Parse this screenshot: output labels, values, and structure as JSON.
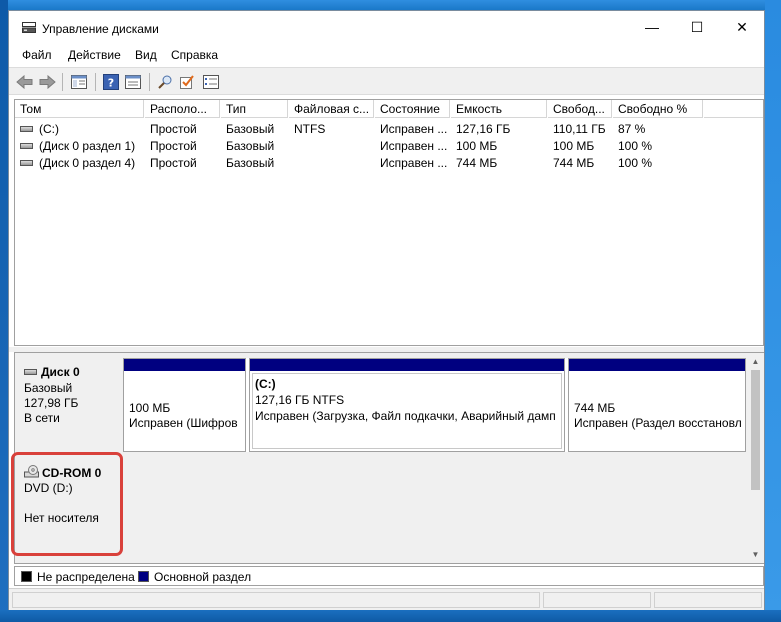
{
  "window": {
    "title": "Управление дисками",
    "controls": {
      "minimize": "—",
      "maximize": "☐",
      "close": "✕"
    }
  },
  "menu": [
    "Файл",
    "Действие",
    "Вид",
    "Справка"
  ],
  "toolbar": [
    "back-arrow-icon",
    "forward-arrow-icon",
    "console-tree-icon",
    "help-icon",
    "properties-pane-icon",
    "rescan-icon",
    "check-icon",
    "list-view-icon"
  ],
  "volume_list": {
    "columns": [
      "Том",
      "Располо...",
      "Тип",
      "Файловая с...",
      "Состояние",
      "Емкость",
      "Свобод...",
      "Свободно %"
    ],
    "rows": [
      [
        "(C:)",
        "Простой",
        "Базовый",
        "NTFS",
        "Исправен ...",
        "127,16 ГБ",
        "110,11 ГБ",
        "87 %"
      ],
      [
        "(Диск 0 раздел 1)",
        "Простой",
        "Базовый",
        "",
        "Исправен ...",
        "100 МБ",
        "100 МБ",
        "100 %"
      ],
      [
        "(Диск 0 раздел 4)",
        "Простой",
        "Базовый",
        "",
        "Исправен ...",
        "744 МБ",
        "744 МБ",
        "100 %"
      ]
    ]
  },
  "disks": {
    "disk0": {
      "name": "Диск 0",
      "type": "Базовый",
      "size": "127,98 ГБ",
      "status": "В сети",
      "partitions": [
        {
          "title": "",
          "size": "100 МБ",
          "status": "Исправен (Шифров"
        },
        {
          "title": "(C:)",
          "size": "127,16 ГБ NTFS",
          "status": "Исправен (Загрузка, Файл подкачки, Аварийный дамп"
        },
        {
          "title": "",
          "size": "744 МБ",
          "status": "Исправен (Раздел восстановл"
        }
      ]
    },
    "cdrom0": {
      "name": "CD-ROM 0",
      "drive": "DVD (D:)",
      "status": "Нет носителя"
    }
  },
  "legend": [
    {
      "label": "Не распределена",
      "color": "#000000"
    },
    {
      "label": "Основной раздел",
      "color": "#000080"
    }
  ],
  "colors": {
    "primary_partition": "#000080",
    "highlight": "#d9413b"
  }
}
